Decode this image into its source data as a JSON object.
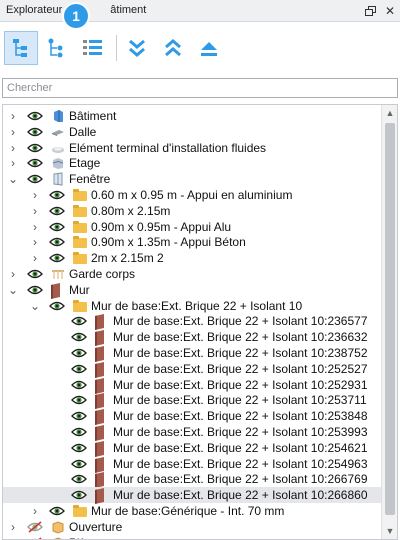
{
  "window": {
    "title_start": "Explorateur",
    "title_end": "âtiment",
    "float_icon": "float-window-icon",
    "close_label": "✕"
  },
  "callout": {
    "number": "1"
  },
  "toolbar": {
    "buttons": [
      {
        "name": "tree-by-category-icon",
        "active": true
      },
      {
        "name": "tree-by-hierarchy-icon",
        "active": false
      },
      {
        "name": "tree-list-icon",
        "active": false
      },
      {
        "name": "expand-all-icon",
        "active": false
      },
      {
        "name": "collapse-all-icon",
        "active": false
      },
      {
        "name": "collapse-to-top-icon",
        "active": false
      }
    ],
    "accent": "#2f9be8"
  },
  "search": {
    "placeholder": "Chercher",
    "value": ""
  },
  "tree": {
    "rows": [
      {
        "level": 0,
        "expander": "collapsed",
        "eye": "visible",
        "icon": "building-icon",
        "label": "Bâtiment"
      },
      {
        "level": 0,
        "expander": "collapsed",
        "eye": "visible",
        "icon": "slab-icon",
        "label": "Dalle"
      },
      {
        "level": 0,
        "expander": "collapsed",
        "eye": "visible",
        "icon": "fluid-terminal-icon",
        "label": "Elément terminal d'installation fluides"
      },
      {
        "level": 0,
        "expander": "collapsed",
        "eye": "visible",
        "icon": "storey-icon",
        "label": "Etage"
      },
      {
        "level": 0,
        "expander": "expanded",
        "eye": "visible",
        "icon": "window-icon",
        "label": "Fenêtre"
      },
      {
        "level": 1,
        "expander": "collapsed",
        "eye": "visible",
        "icon": "folder-icon",
        "label": "0.60 m x 0.95 m - Appui en aluminium"
      },
      {
        "level": 1,
        "expander": "collapsed",
        "eye": "visible",
        "icon": "folder-icon",
        "label": "0.80m x 2.15m"
      },
      {
        "level": 1,
        "expander": "collapsed",
        "eye": "visible",
        "icon": "folder-icon",
        "label": "0.90m x 0.95m - Appui Alu"
      },
      {
        "level": 1,
        "expander": "collapsed",
        "eye": "visible",
        "icon": "folder-icon",
        "label": "0.90m x 1.35m - Appui Béton"
      },
      {
        "level": 1,
        "expander": "collapsed",
        "eye": "visible",
        "icon": "folder-icon",
        "label": "2m x 2.15m 2"
      },
      {
        "level": 0,
        "expander": "collapsed",
        "eye": "visible",
        "icon": "railing-icon",
        "label": "Garde corps"
      },
      {
        "level": 0,
        "expander": "expanded",
        "eye": "visible",
        "icon": "wall-icon",
        "label": "Mur"
      },
      {
        "level": 1,
        "expander": "expanded",
        "eye": "visible",
        "icon": "folder-icon",
        "label": "Mur de base:Ext. Brique 22 + Isolant 10"
      },
      {
        "level": 2,
        "expander": "none",
        "eye": "visible",
        "icon": "wall-icon",
        "label": "Mur de base:Ext. Brique 22 + Isolant 10:236577"
      },
      {
        "level": 2,
        "expander": "none",
        "eye": "visible",
        "icon": "wall-icon",
        "label": "Mur de base:Ext. Brique 22 + Isolant 10:236632"
      },
      {
        "level": 2,
        "expander": "none",
        "eye": "visible",
        "icon": "wall-icon",
        "label": "Mur de base:Ext. Brique 22 + Isolant 10:238752"
      },
      {
        "level": 2,
        "expander": "none",
        "eye": "visible",
        "icon": "wall-icon",
        "label": "Mur de base:Ext. Brique 22 + Isolant 10:252527"
      },
      {
        "level": 2,
        "expander": "none",
        "eye": "visible",
        "icon": "wall-icon",
        "label": "Mur de base:Ext. Brique 22 + Isolant 10:252931"
      },
      {
        "level": 2,
        "expander": "none",
        "eye": "visible",
        "icon": "wall-icon",
        "label": "Mur de base:Ext. Brique 22 + Isolant 10:253711"
      },
      {
        "level": 2,
        "expander": "none",
        "eye": "visible",
        "icon": "wall-icon",
        "label": "Mur de base:Ext. Brique 22 + Isolant 10:253848"
      },
      {
        "level": 2,
        "expander": "none",
        "eye": "visible",
        "icon": "wall-icon",
        "label": "Mur de base:Ext. Brique 22 + Isolant 10:253993"
      },
      {
        "level": 2,
        "expander": "none",
        "eye": "visible",
        "icon": "wall-icon",
        "label": "Mur de base:Ext. Brique 22 + Isolant 10:254621"
      },
      {
        "level": 2,
        "expander": "none",
        "eye": "visible",
        "icon": "wall-icon",
        "label": "Mur de base:Ext. Brique 22 + Isolant 10:254963"
      },
      {
        "level": 2,
        "expander": "none",
        "eye": "visible",
        "icon": "wall-icon",
        "label": "Mur de base:Ext. Brique 22 + Isolant 10:266769"
      },
      {
        "level": 2,
        "expander": "none",
        "eye": "visible",
        "icon": "wall-icon",
        "label": "Mur de base:Ext. Brique 22 + Isolant 10:266860",
        "selected": true
      },
      {
        "level": 1,
        "expander": "collapsed",
        "eye": "visible",
        "icon": "folder-icon",
        "label": "Mur de base:Générique - Int. 70 mm"
      },
      {
        "level": 0,
        "expander": "collapsed",
        "eye": "hidden",
        "icon": "opening-icon",
        "label": "Ouverture"
      },
      {
        "level": 0,
        "expander": "collapsed",
        "eye": "hidden",
        "icon": "opening-icon",
        "label": "Pièce"
      }
    ]
  }
}
